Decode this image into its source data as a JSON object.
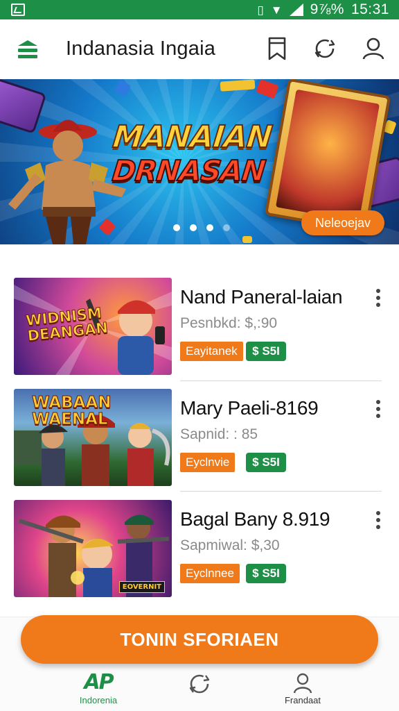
{
  "status_bar": {
    "battery": "9⅞%",
    "time": "15:31"
  },
  "app_bar": {
    "title": "Indanasia Ingaia"
  },
  "banner": {
    "headline_line1": "MANAIAN",
    "headline_line2": "DRNASAN",
    "button_label": "Neleoejav",
    "carousel_pages": 4,
    "active_page": 1
  },
  "games": [
    {
      "thumbnail_title": "WIDNISM DEANGAN",
      "title": "Nand Paneral-laian",
      "price_line": "Pesnbkd:  $,:90",
      "genre": "Eayitanek",
      "price": "$ S5I"
    },
    {
      "thumbnail_title": "WABAAN WAENAL",
      "title": "Mary Paeli-8169",
      "price_line": "Sapnid: : 85",
      "genre": "Eyclnvie",
      "price": "$ S5I"
    },
    {
      "thumbnail_title": "",
      "thumbnail_badge": "EOVERNIT",
      "title": "Bagal Bany 8.919",
      "price_line": "Sapmiwal:  $,30",
      "genre": "Eyclnnee",
      "price": "$ S5I"
    }
  ],
  "cta": {
    "label": "TONIN SFORIAEN"
  },
  "bottom_nav": {
    "items": [
      {
        "logo": "AP",
        "label": "Indorenia",
        "active": true
      },
      {
        "label": "",
        "icon": "refresh-icon"
      },
      {
        "label": "Frandaat",
        "icon": "person-icon"
      }
    ]
  },
  "colors": {
    "brand_green": "#1e8f47",
    "accent_orange": "#f07a1a"
  }
}
